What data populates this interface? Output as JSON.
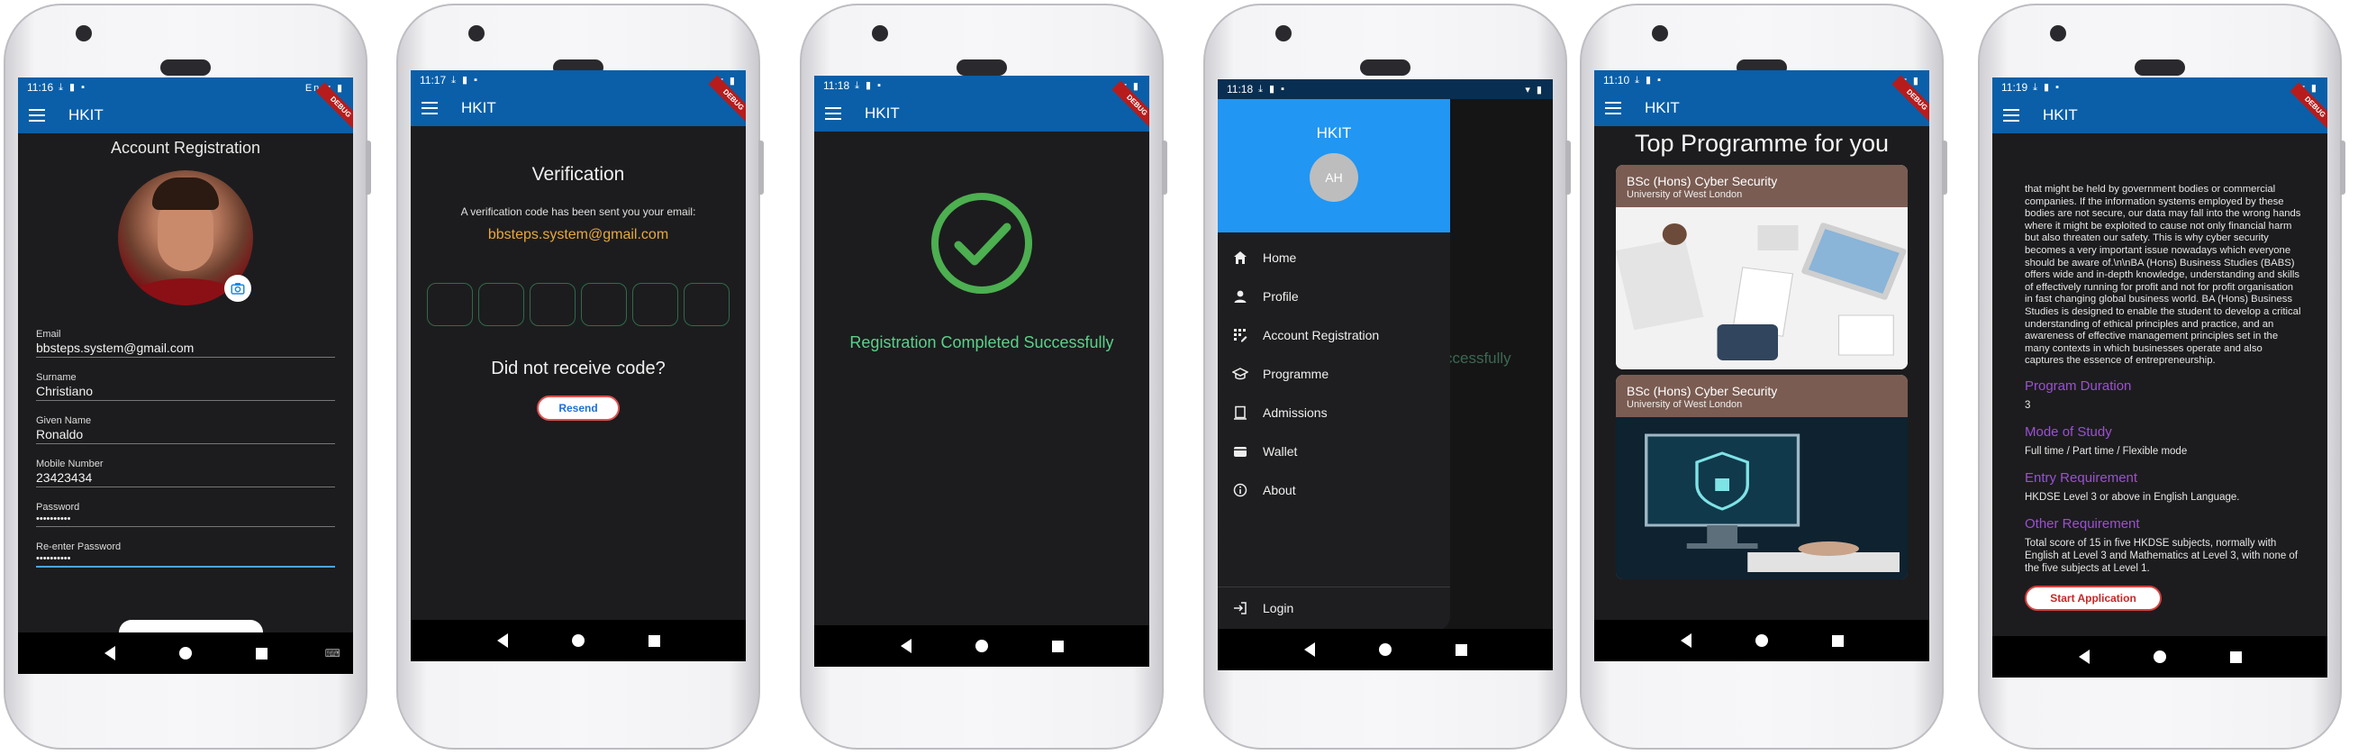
{
  "app": {
    "title": "HKIT",
    "debug_banner": "DEBUG"
  },
  "phones": [
    {
      "time": "11:16",
      "status_extra": "En"
    },
    {
      "time": "11:17"
    },
    {
      "time": "11:18"
    },
    {
      "time": "11:18"
    },
    {
      "time": "11:10"
    },
    {
      "time": "11:19"
    }
  ],
  "registration": {
    "title": "Account Registration",
    "fields": [
      {
        "label": "Email",
        "value": "bbsteps.system@gmail.com"
      },
      {
        "label": "Surname",
        "value": "Christiano"
      },
      {
        "label": "Given Name",
        "value": "Ronaldo"
      },
      {
        "label": "Mobile Number",
        "value": "23423434"
      },
      {
        "label": "Password",
        "value": "••••••••••"
      },
      {
        "label": "Re-enter Password",
        "value": "••••••••••"
      }
    ]
  },
  "verification": {
    "title": "Verification",
    "message": "A verification code has been sent you your email:",
    "email": "bbsteps.system@gmail.com",
    "question": "Did not receive code?",
    "resend_label": "Resend"
  },
  "success": {
    "message": "Registration Completed Successfully",
    "partial": "ccessfully"
  },
  "drawer": {
    "title": "HKIT",
    "avatar_initials": "AH",
    "items": [
      "Home",
      "Profile",
      "Account Registration",
      "Programme",
      "Admissions",
      "Wallet",
      "About"
    ],
    "login_label": "Login"
  },
  "programmes": {
    "title": "Top Programme for you",
    "cards": [
      {
        "title": "BSc (Hons) Cyber Security",
        "subtitle": "University of West London"
      },
      {
        "title": "BSc (Hons) Cyber Security",
        "subtitle": "University of West London"
      }
    ]
  },
  "programme_detail": {
    "description": "that might be held by government bodies or commercial companies. If the information systems employed by these bodies are not secure, our data may fall into the wrong hands where it might be exploited to cause not only financial harm but also threaten our safety. This is why cyber security becomes a very important issue nowadays which everyone should be aware of.\\n\\nBA (Hons) Business Studies (BABS) offers wide and in-depth knowledge, understanding and skills of effectively running for profit and not for profit organisation in fast changing global business world. BA (Hons) Business Studies is designed to enable the student to develop a critical understanding of ethical principles and practice, and an awareness of effective management principles set in the many contexts in which businesses operate and also captures the essence of entrepreneurship.",
    "sections": [
      {
        "heading": "Program Duration",
        "value": "3"
      },
      {
        "heading": "Mode of Study",
        "value": "Full time / Part time / Flexible mode"
      },
      {
        "heading": "Entry Requirement",
        "value": "HKDSE Level 3 or above in English Language."
      },
      {
        "heading": "Other Requirement",
        "value": "Total score of 15 in five HKDSE subjects, normally with English at Level 3 and Mathematics at Level 3, with none of the five subjects at Level 1."
      }
    ],
    "start_label": "Start Application"
  },
  "colors": {
    "appbar": "#0a5fa8",
    "drawer_header": "#2196f3",
    "success_green": "#5cd089",
    "accent_purple": "#9c4fd6",
    "email_orange": "#e6a93a"
  }
}
